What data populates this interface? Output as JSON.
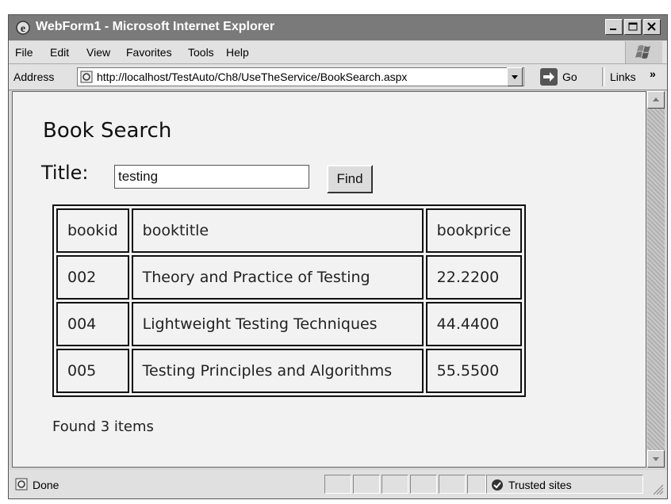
{
  "window": {
    "title": "WebForm1 - Microsoft Internet Explorer"
  },
  "menu": {
    "items": [
      "File",
      "Edit",
      "View",
      "Favorites",
      "Tools",
      "Help"
    ]
  },
  "address": {
    "label": "Address",
    "url": "http://localhost/TestAuto/Ch8/UseTheService/BookSearch.aspx",
    "go_label": "Go",
    "links_label": "Links",
    "links_chevron": "»"
  },
  "page": {
    "heading": "Book Search",
    "title_label": "Title:",
    "search_value": "testing",
    "find_label": "Find",
    "table": {
      "headers": [
        "bookid",
        "booktitle",
        "bookprice"
      ],
      "rows": [
        [
          "002",
          "Theory and Practice of Testing",
          "22.2200"
        ],
        [
          "004",
          "Lightweight Testing Techniques",
          "44.4400"
        ],
        [
          "005",
          "Testing Principles and Algorithms",
          "55.5500"
        ]
      ]
    },
    "found_text": "Found 3 items"
  },
  "status": {
    "text": "Done",
    "zone": "Trusted sites"
  },
  "icons": {
    "app": "ie-logo-icon",
    "minimize": "minimize-icon",
    "maximize": "maximize-icon",
    "close": "close-icon",
    "page": "page-icon",
    "dropdown": "chevron-down-icon",
    "go": "go-arrow-icon",
    "zone": "checkmark-icon"
  }
}
